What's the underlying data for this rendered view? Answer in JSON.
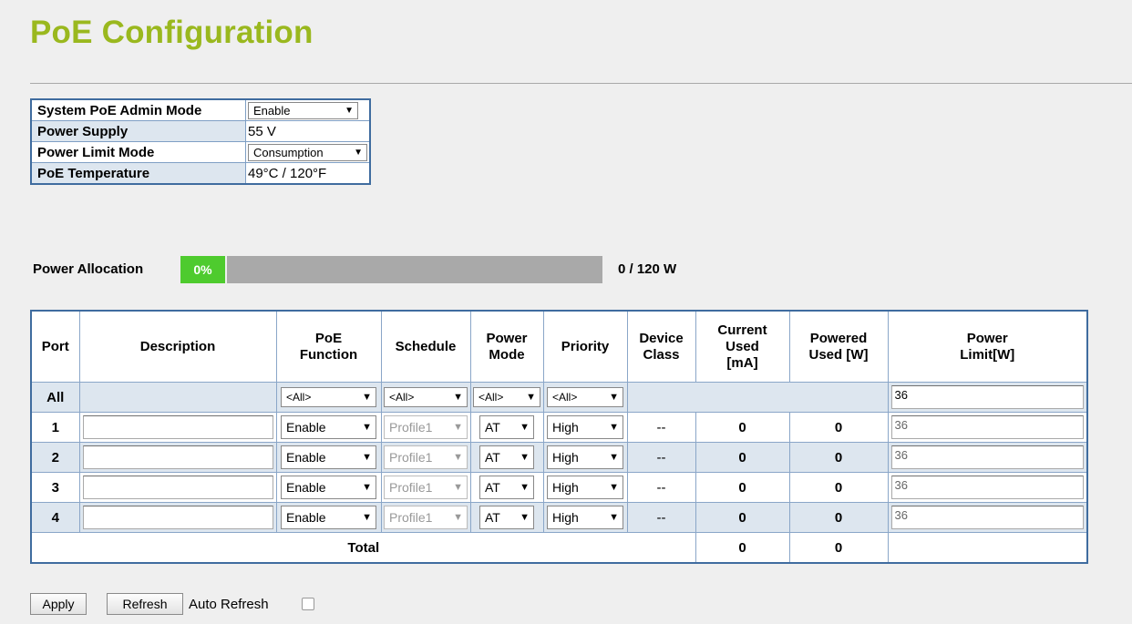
{
  "page": {
    "title": "PoE Configuration"
  },
  "system": {
    "admin_mode_label": "System PoE Admin Mode",
    "admin_mode_value": "Enable",
    "power_supply_label": "Power Supply",
    "power_supply_value": "55  V",
    "limit_mode_label": "Power Limit Mode",
    "limit_mode_value": "Consumption",
    "temperature_label": "PoE Temperature",
    "temperature_value": "49°C / 120°F"
  },
  "allocation": {
    "label": "Power Allocation",
    "percent_text": "0%",
    "fill_fraction": 0,
    "total_text": "0 / 120 W",
    "colors": {
      "accent": "#4ecb2e",
      "bar": "#a9a9a9",
      "title": "#9ab81e",
      "border": "#3f6c9f"
    }
  },
  "table": {
    "headers": {
      "port": "Port",
      "description": "Description",
      "poe_function_1": "PoE",
      "poe_function_2": "Function",
      "schedule": "Schedule",
      "power_mode_1": "Power",
      "power_mode_2": "Mode",
      "priority": "Priority",
      "device_class_1": "Device",
      "device_class_2": "Class",
      "current_used_1": "Current",
      "current_used_2": "Used",
      "current_used_3": "[mA]",
      "powered_used_1": "Powered",
      "powered_used_2": "Used [W]",
      "power_limit_1": "Power",
      "power_limit_2": "Limit[W]"
    },
    "all_row": {
      "port": "All",
      "function": "<All>",
      "schedule": "<All>",
      "mode": "<All>",
      "priority": "<All>",
      "limit": "36"
    },
    "rows": [
      {
        "port": "1",
        "description": "",
        "function": "Enable",
        "schedule": "Profile1",
        "mode": "AT",
        "priority": "High",
        "device_class": "--",
        "current": "0",
        "powered": "0",
        "limit": "36"
      },
      {
        "port": "2",
        "description": "",
        "function": "Enable",
        "schedule": "Profile1",
        "mode": "AT",
        "priority": "High",
        "device_class": "--",
        "current": "0",
        "powered": "0",
        "limit": "36"
      },
      {
        "port": "3",
        "description": "",
        "function": "Enable",
        "schedule": "Profile1",
        "mode": "AT",
        "priority": "High",
        "device_class": "--",
        "current": "0",
        "powered": "0",
        "limit": "36"
      },
      {
        "port": "4",
        "description": "",
        "function": "Enable",
        "schedule": "Profile1",
        "mode": "AT",
        "priority": "High",
        "device_class": "--",
        "current": "0",
        "powered": "0",
        "limit": "36"
      }
    ],
    "total": {
      "label": "Total",
      "current": "0",
      "powered": "0"
    }
  },
  "buttons": {
    "apply": "Apply",
    "refresh": "Refresh",
    "auto_refresh": "Auto Refresh"
  }
}
